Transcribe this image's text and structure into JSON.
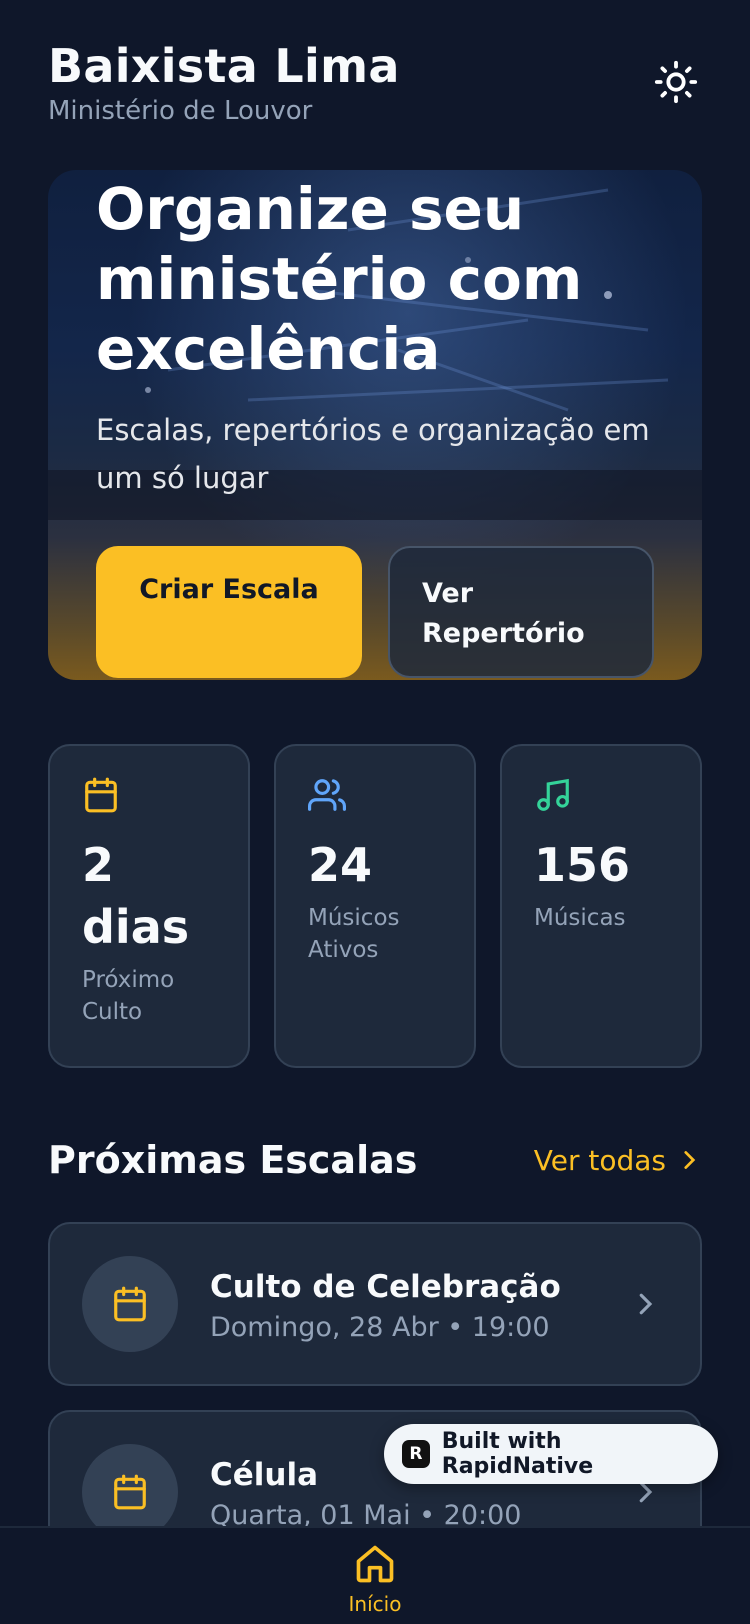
{
  "header": {
    "title": "Baixista Lima",
    "subtitle": "Ministério de Louvor",
    "theme_icon": "sun-icon"
  },
  "hero": {
    "title": "Organize seu ministério com excelência",
    "subtitle": "Escalas, repertórios e organização em um só lugar",
    "primary_button": "Criar Escala",
    "secondary_button": "Ver Repertório"
  },
  "stats": [
    {
      "icon": "calendar-icon",
      "color": "#fbbf24",
      "value": "2 dias",
      "label": "Próximo Culto"
    },
    {
      "icon": "users-icon",
      "color": "#60a5fa",
      "value": "24",
      "label": "Músicos Ativos"
    },
    {
      "icon": "music-icon",
      "color": "#34d399",
      "value": "156",
      "label": "Músicas"
    }
  ],
  "section": {
    "title": "Próximas Escalas",
    "see_all": "Ver todas"
  },
  "schedules": [
    {
      "title": "Culto de Celebração",
      "date": "Domingo, 28 Abr • 19:00"
    },
    {
      "title": "Célula",
      "date": "Quarta, 01 Mai • 20:00"
    }
  ],
  "badge": {
    "text": "Built with RapidNative",
    "logo": "R"
  },
  "nav": {
    "home_label": "Início",
    "active_color": "#fbbf24"
  },
  "colors": {
    "accent": "#fbbf24",
    "background": "#0f172a",
    "card": "#1e293b"
  }
}
